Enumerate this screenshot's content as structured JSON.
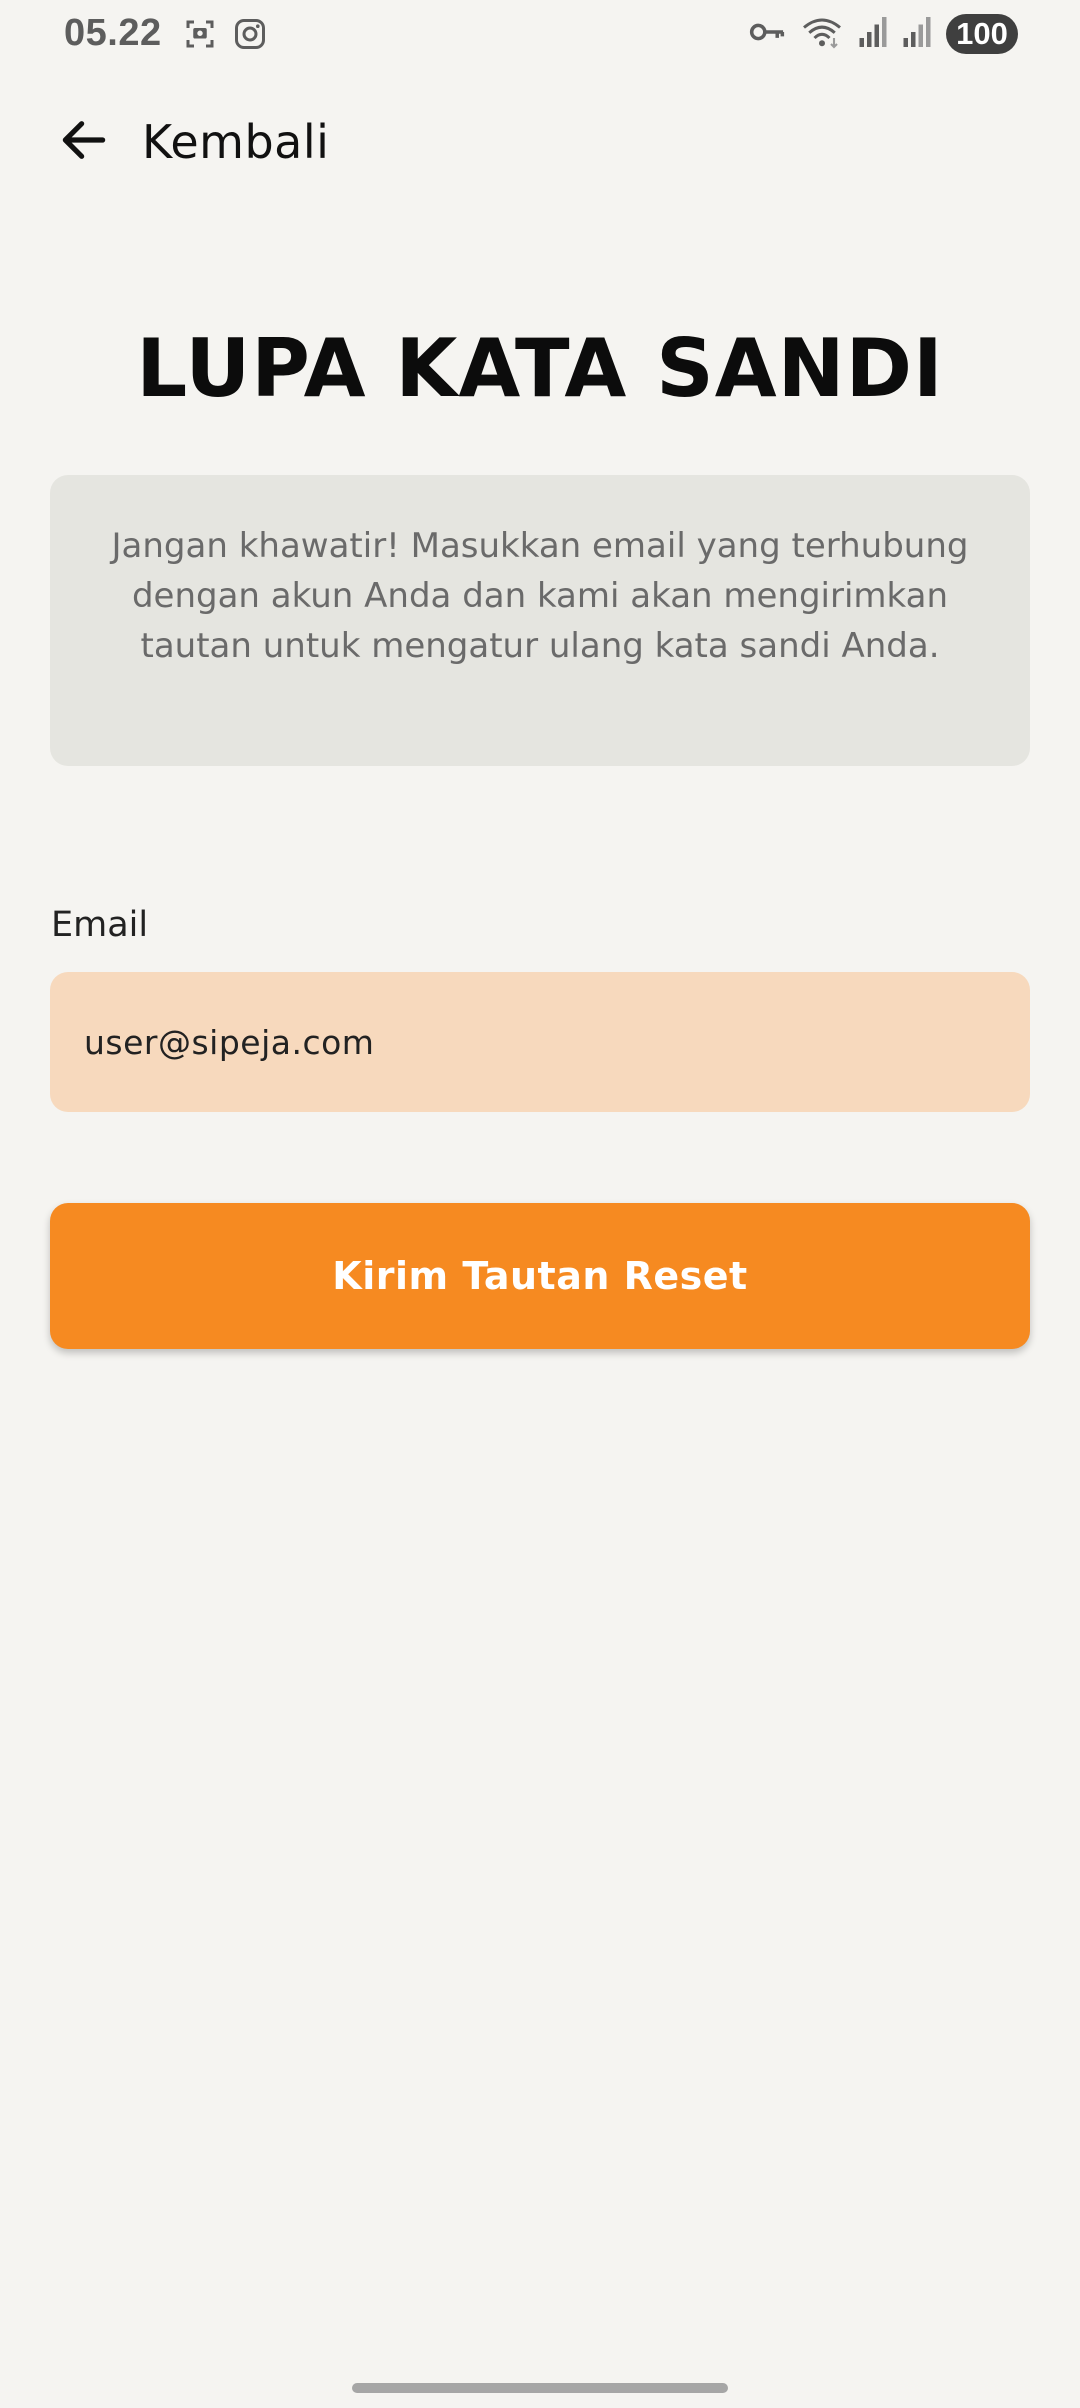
{
  "status_bar": {
    "time": "05.22",
    "battery": "100",
    "icons_left": [
      "screenshot-icon",
      "instagram-icon"
    ],
    "icons_right": [
      "vpn-key-icon",
      "wifi-icon",
      "signal-icon",
      "signal-icon"
    ]
  },
  "nav": {
    "back_label": "Kembali"
  },
  "page": {
    "title": "LUPA KATA SANDI",
    "info_text": "Jangan khawatir! Masukkan email yang terhubung dengan akun Anda dan kami akan mengirimkan tautan untuk mengatur ulang kata sandi Anda."
  },
  "form": {
    "email_label": "Email",
    "email_value": "user@sipeja.com",
    "submit_label": "Kirim Tautan Reset"
  },
  "colors": {
    "background": "#f5f4f1",
    "accent": "#f68a21",
    "input_bg": "#f7d9bd",
    "info_bg": "#e5e5e0"
  }
}
